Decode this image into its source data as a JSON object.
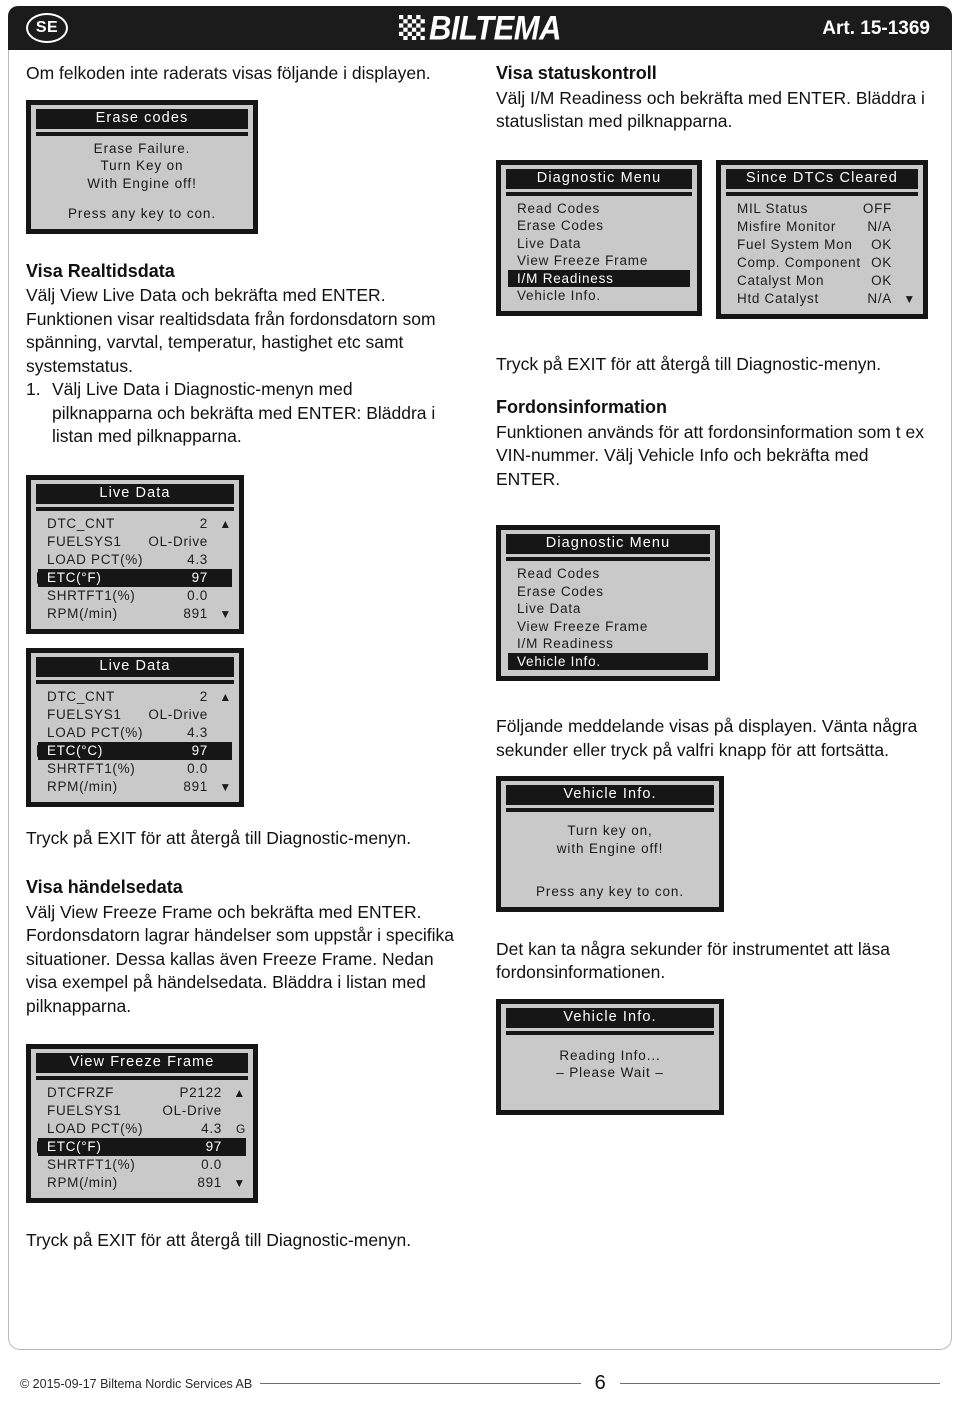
{
  "header": {
    "country_badge": "SE",
    "brand": "BILTEMA",
    "article": "Art. 15-1369"
  },
  "left_column": {
    "intro": "Om felkoden inte raderats visas följande i displayen.",
    "erase_screen": {
      "title": "Erase codes",
      "line1": "Erase Failure.",
      "line2": "Turn Key on",
      "line3": "With Engine off!",
      "line4": "Press any key to con."
    },
    "realtime_heading": "Visa Realtidsdata",
    "realtime_p1": "Välj View Live Data och bekräfta med ENTER. Funktionen visar realtidsdata från fordonsdatorn som spänning, varvtal, temperatur, hastighet etc samt systemstatus.",
    "realtime_step_num": "1.",
    "realtime_step_text": "Välj Live Data i Diagnostic-menyn med pilknapparna och bekräfta med ENTER: Bläddra i listan med pilknapparna.",
    "live_data_f": {
      "title": "Live Data",
      "rows": [
        {
          "label": "DTC_CNT",
          "value": "2",
          "arrow": "▲",
          "selected": false
        },
        {
          "label": "FUELSYS1",
          "value": "OL-Drive",
          "arrow": "",
          "selected": false
        },
        {
          "label": "LOAD  PCT(%)",
          "value": "4.3",
          "arrow": "",
          "selected": false
        },
        {
          "label": "ETC(°F)",
          "value": "97",
          "arrow": "",
          "selected": true
        },
        {
          "label": "SHRTFT1(%)",
          "value": "0.0",
          "arrow": "",
          "selected": false
        },
        {
          "label": "RPM(/min)",
          "value": "891",
          "arrow": "▼",
          "selected": false
        }
      ]
    },
    "live_data_c": {
      "title": "Live Data",
      "rows": [
        {
          "label": "DTC_CNT",
          "value": "2",
          "arrow": "▲",
          "selected": false
        },
        {
          "label": "FUELSYS1",
          "value": "OL-Drive",
          "arrow": "",
          "selected": false
        },
        {
          "label": "LOAD  PCT(%)",
          "value": "4.3",
          "arrow": "",
          "selected": false
        },
        {
          "label": "ETC(°C)",
          "value": "97",
          "arrow": "",
          "selected": true
        },
        {
          "label": "SHRTFT1(%)",
          "value": "0.0",
          "arrow": "",
          "selected": false
        },
        {
          "label": "RPM(/min)",
          "value": "891",
          "arrow": "▼",
          "selected": false
        }
      ]
    },
    "exit_note_1": "Tryck på EXIT för att återgå till Diagnostic-menyn.",
    "event_heading": "Visa händelsedata",
    "event_text": "Välj View Freeze Frame och bekräfta med ENTER. Fordonsdatorn lagrar händelser som uppstår i specifika situationer. Dessa kallas även Freeze Frame. Nedan visa exempel på händelsedata. Bläddra i listan med pilknapparna.",
    "freeze_frame": {
      "title": "View Freeze Frame",
      "rows": [
        {
          "label": "DTCFRZF",
          "value": "P2122",
          "arrow": "▲",
          "selected": false
        },
        {
          "label": "FUELSYS1",
          "value": "OL-Drive",
          "arrow": "",
          "selected": false
        },
        {
          "label": "LOAD  PCT(%)",
          "value": "4.3",
          "arrow": "G",
          "selected": false
        },
        {
          "label": "ETC(°F)",
          "value": "97",
          "arrow": "",
          "selected": true
        },
        {
          "label": "SHRTFT1(%)",
          "value": "0.0",
          "arrow": "",
          "selected": false
        },
        {
          "label": "RPM(/min)",
          "value": "891",
          "arrow": "▼",
          "selected": false
        }
      ]
    },
    "exit_note_2": "Tryck på EXIT för att återgå till Diagnostic-menyn."
  },
  "right_column": {
    "status_heading": "Visa statuskontroll",
    "status_text": "Välj I/M Readiness och bekräfta med ENTER. Bläddra i statuslistan med pilknapparna.",
    "diag_menu_1": {
      "title": "Diagnostic Menu",
      "items": [
        {
          "label": "Read Codes",
          "selected": false
        },
        {
          "label": "Erase Codes",
          "selected": false
        },
        {
          "label": "Live Data",
          "selected": false
        },
        {
          "label": "View Freeze Frame",
          "selected": false
        },
        {
          "label": "I/M Readiness",
          "selected": true
        },
        {
          "label": "Vehicle Info.",
          "selected": false
        }
      ]
    },
    "since_cleared": {
      "title": "Since DTCs Cleared",
      "rows": [
        {
          "label": "MIL Status",
          "value": "OFF",
          "arrow": ""
        },
        {
          "label": "Misfire Monitor",
          "value": "N/A",
          "arrow": ""
        },
        {
          "label": "Fuel System Mon",
          "value": "OK",
          "arrow": ""
        },
        {
          "label": "Comp. Component",
          "value": "OK",
          "arrow": ""
        },
        {
          "label": "Catalyst Mon",
          "value": "OK",
          "arrow": ""
        },
        {
          "label": "Htd Catalyst",
          "value": "N/A",
          "arrow": "▼"
        }
      ]
    },
    "exit_note_1": "Tryck på EXIT för att återgå till Diagnostic-menyn.",
    "vehicle_heading": "Fordonsinformation",
    "vehicle_text": "Funktionen används för att fordonsinformation som t ex VIN-nummer. Välj Vehicle Info och bekräfta med ENTER.",
    "diag_menu_2": {
      "title": "Diagnostic Menu",
      "items": [
        {
          "label": "Read Codes",
          "selected": false
        },
        {
          "label": "Erase Codes",
          "selected": false
        },
        {
          "label": "Live Data",
          "selected": false
        },
        {
          "label": "View Freeze Frame",
          "selected": false
        },
        {
          "label": "I/M Readiness",
          "selected": false
        },
        {
          "label": "Vehicle Info.",
          "selected": true
        }
      ]
    },
    "message_text": "Följande meddelande visas på displayen. Vänta några sekunder eller tryck på valfri knapp för att fortsätta.",
    "vehicle_info_1": {
      "title": "Vehicle Info.",
      "line1": "Turn key on,",
      "line2": "with Engine off!",
      "line3": "Press any key to con."
    },
    "reading_text": "Det kan ta några sekunder för instrumentet att läsa fordonsinformationen.",
    "vehicle_info_2": {
      "title": "Vehicle Info.",
      "line1": "Reading Info...",
      "line2": "– Please Wait –"
    }
  },
  "footer": {
    "copyright": "© 2015-09-17 Biltema Nordic Services AB",
    "page_number": "6"
  }
}
